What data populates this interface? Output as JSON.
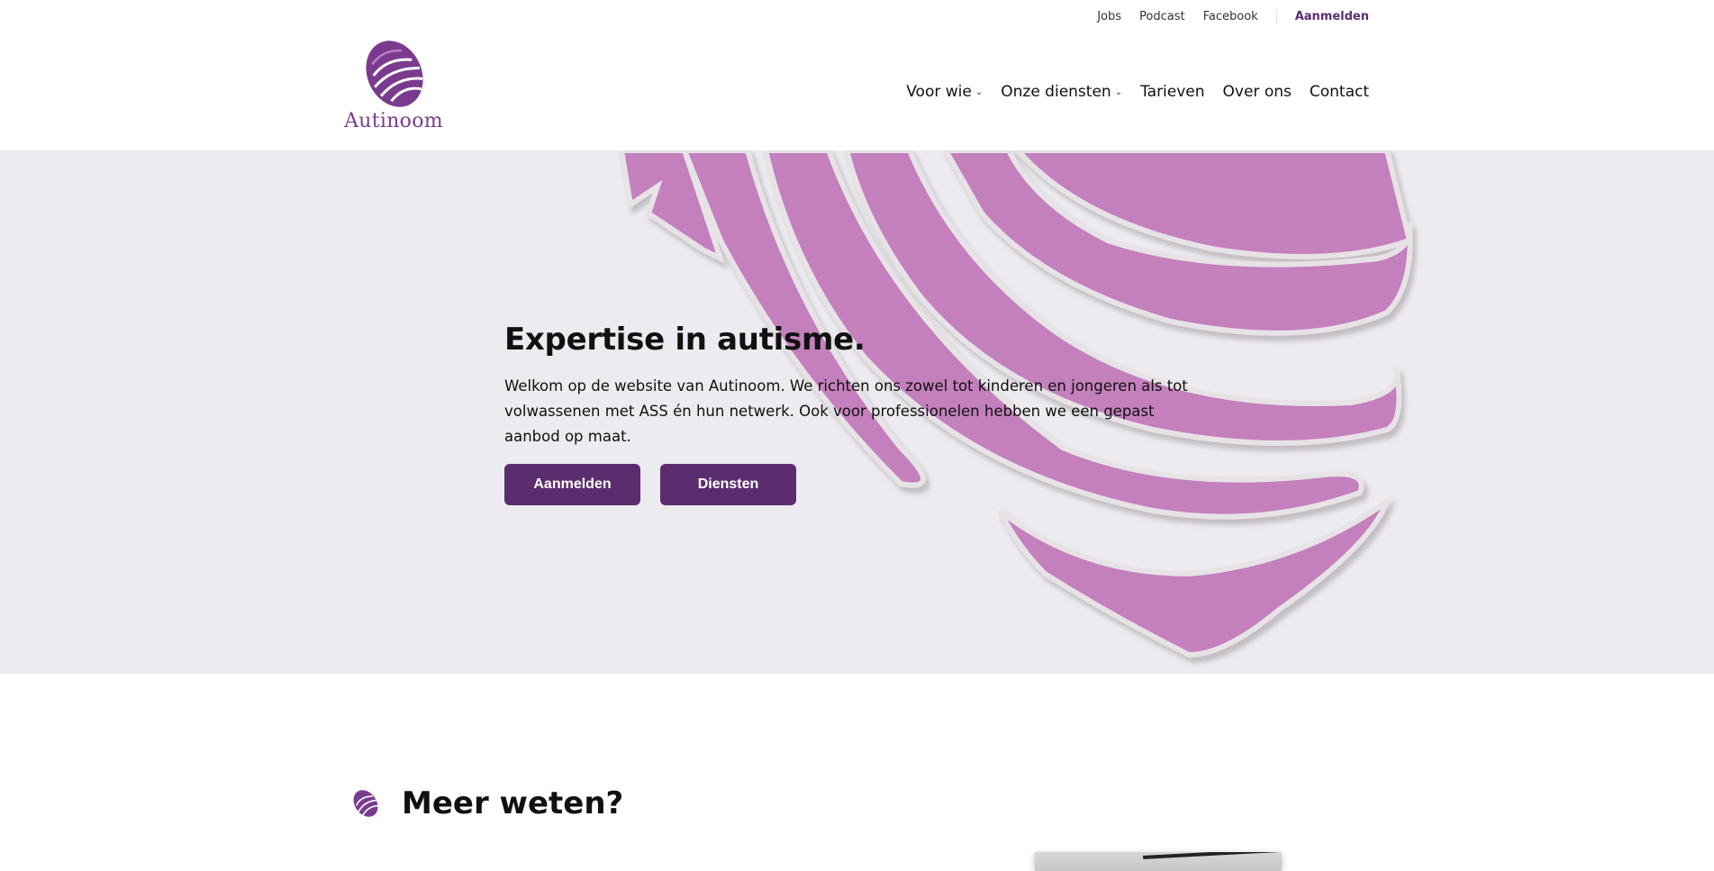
{
  "topbar": {
    "links": [
      "Jobs",
      "Podcast",
      "Facebook"
    ],
    "signup": "Aanmelden"
  },
  "header": {
    "logo_text": "Autinoom",
    "logo_icon": "fingerprint-icon",
    "nav": [
      {
        "label": "Voor wie",
        "dropdown": true
      },
      {
        "label": "Onze diensten",
        "dropdown": true
      },
      {
        "label": "Tarieven",
        "dropdown": false
      },
      {
        "label": "Over ons",
        "dropdown": false
      },
      {
        "label": "Contact",
        "dropdown": false
      }
    ]
  },
  "hero": {
    "title": "Expertise in autisme.",
    "text": "Welkom op de website van Autinoom. We richten ons zowel tot kinderen en jongeren als tot volwassenen met ASS én hun netwerk. Ook voor professionelen hebben we een gepast aanbod op maat.",
    "buttons": [
      "Aanmelden",
      "Diensten"
    ]
  },
  "more": {
    "title": "Meer weten?",
    "icon": "fingerprint-icon"
  },
  "colors": {
    "accent": "#5b2d6e",
    "brand_purple": "#7a3b8f",
    "hero_bg": "#ecebef",
    "deco_purple": "#c47fbd"
  }
}
